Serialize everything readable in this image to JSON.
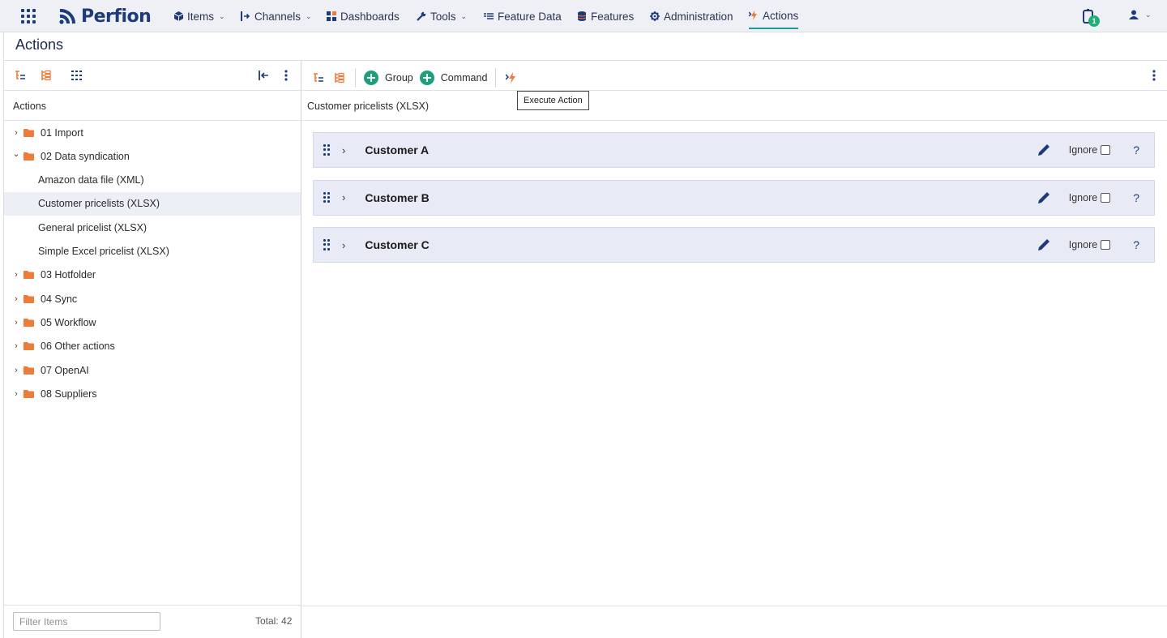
{
  "topnav": {
    "brand": "Perfion",
    "items": [
      {
        "label": "Items",
        "icon": "cube-icon",
        "has_menu": true
      },
      {
        "label": "Channels",
        "icon": "channels-icon",
        "has_menu": true
      },
      {
        "label": "Dashboards",
        "icon": "dashboards-icon",
        "has_menu": false
      },
      {
        "label": "Tools",
        "icon": "wrench-icon",
        "has_menu": true
      },
      {
        "label": "Feature Data",
        "icon": "list-icon",
        "has_menu": false
      },
      {
        "label": "Features",
        "icon": "database-icon",
        "has_menu": false
      },
      {
        "label": "Administration",
        "icon": "gear-icon",
        "has_menu": false
      },
      {
        "label": "Actions",
        "icon": "actions-icon",
        "has_menu": false,
        "active": true
      }
    ],
    "notification_count": "1",
    "colors": {
      "brand": "#1d3a7a",
      "active_underline": "#1a9aa0",
      "badge": "#1fae76",
      "folder": "#ef7b3a"
    }
  },
  "page": {
    "title": "Actions"
  },
  "left_panel": {
    "header": "Actions",
    "tree": [
      {
        "label": "01 Import",
        "type": "folder",
        "expanded": false
      },
      {
        "label": "02 Data syndication",
        "type": "folder",
        "expanded": true
      },
      {
        "label": "Amazon data file (XML)",
        "type": "leaf"
      },
      {
        "label": "Customer pricelists (XLSX)",
        "type": "leaf",
        "selected": true
      },
      {
        "label": "General pricelist (XLSX)",
        "type": "leaf"
      },
      {
        "label": "Simple Excel pricelist (XLSX)",
        "type": "leaf"
      },
      {
        "label": "03 Hotfolder",
        "type": "folder",
        "expanded": false
      },
      {
        "label": "04 Sync",
        "type": "folder",
        "expanded": false
      },
      {
        "label": "05 Workflow",
        "type": "folder",
        "expanded": false
      },
      {
        "label": "06 Other actions",
        "type": "folder",
        "expanded": false
      },
      {
        "label": "07 OpenAI",
        "type": "folder",
        "expanded": false
      },
      {
        "label": "08 Suppliers",
        "type": "folder",
        "expanded": false
      }
    ],
    "filter_placeholder": "Filter Items",
    "total": "Total: 42"
  },
  "right_panel": {
    "toolbar": {
      "group_label": "Group",
      "command_label": "Command"
    },
    "tooltip": "Execute Action",
    "breadcrumb": "Customer pricelists (XLSX)",
    "groups": [
      {
        "name": "Customer A",
        "ignore_label": "Ignore",
        "help": "?"
      },
      {
        "name": "Customer B",
        "ignore_label": "Ignore",
        "help": "?"
      },
      {
        "name": "Customer C",
        "ignore_label": "Ignore",
        "help": "?"
      }
    ]
  }
}
